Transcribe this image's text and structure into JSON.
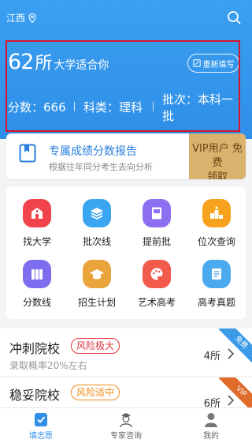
{
  "header": {
    "location": "江西",
    "count_number": "62",
    "count_unit": "所",
    "count_suffix": "大学适合你",
    "refill_label": "重新填写",
    "score_text": "分数：666",
    "subject_text": "科类：理科",
    "batch_text": "批次：本科一批"
  },
  "report": {
    "title": "专属成绩分数报告",
    "subtitle": "根据往年同分考生去向分析",
    "vip_line1": "VIP用户 免费",
    "vip_line2": "领取"
  },
  "grid": {
    "items": [
      {
        "label": "找大学",
        "icon": "school-icon",
        "color": "#f0434c"
      },
      {
        "label": "批次线",
        "icon": "layers-icon",
        "color": "#3aa6f2"
      },
      {
        "label": "提前批",
        "icon": "book-icon",
        "color": "#8d6ff2"
      },
      {
        "label": "位次查询",
        "icon": "podium-icon",
        "color": "#f6a21c"
      },
      {
        "label": "分数线",
        "icon": "columns-icon",
        "color": "#7d6ef0"
      },
      {
        "label": "招生计划",
        "icon": "graduation-cap-icon",
        "color": "#e9a43c"
      },
      {
        "label": "艺术高考",
        "icon": "palette-icon",
        "color": "#f25a4c"
      },
      {
        "label": "高考真题",
        "icon": "scroll-icon",
        "color": "#4ba9ef"
      }
    ]
  },
  "cards": [
    {
      "title": "冲刺院校",
      "risk": "风险极大",
      "subtitle": "录取概率20%左右",
      "count": "4所",
      "ribbon": "免费",
      "ribbon_color": "#3c9be9"
    },
    {
      "title": "稳妥院校",
      "risk": "风险适中",
      "subtitle": "",
      "count": "6所",
      "ribbon": "VIP",
      "ribbon_color": "#e06c2c"
    }
  ],
  "tabbar": {
    "tabs": [
      {
        "label": "填志愿",
        "active": true
      },
      {
        "label": "专家咨询",
        "active": false
      },
      {
        "label": "我的",
        "active": false
      }
    ]
  },
  "colors": {
    "primary": "#2f8ee8",
    "vip_gold": "#d9b26d",
    "risk_high": "#e0343c",
    "risk_mid": "#f08a1b"
  }
}
